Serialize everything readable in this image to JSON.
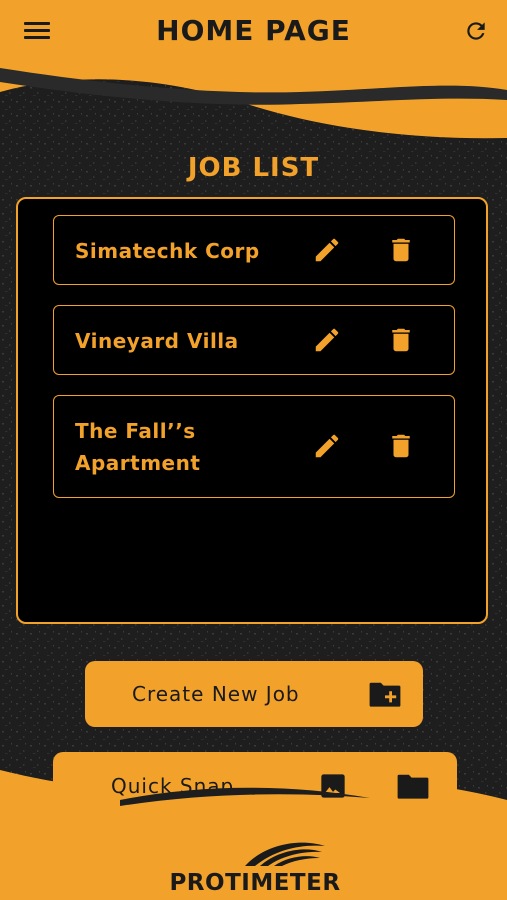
{
  "header": {
    "title": "HOME PAGE",
    "menu_icon": "hamburger-menu-icon",
    "refresh_icon": "refresh-icon"
  },
  "job_list": {
    "title": "JOB LIST",
    "items": [
      {
        "name": "Simatechk Corp"
      },
      {
        "name": "Vineyard Villa"
      },
      {
        "name": "The Fall’’s Apartment"
      }
    ],
    "edit_icon": "pencil-icon",
    "delete_icon": "trash-icon"
  },
  "actions": {
    "create_label": "Create New Job",
    "create_icon": "folder-plus-icon",
    "quick_snap_label": "Quick Snap",
    "quick_snap_icons": [
      "image-icon",
      "folder-icon"
    ]
  },
  "footer": {
    "logo_text": "PROTIMETER"
  },
  "colors": {
    "accent": "#f2a22b",
    "dark": "#000000",
    "texture": "#2a2a2a",
    "text_dark": "#1a1a1a"
  }
}
